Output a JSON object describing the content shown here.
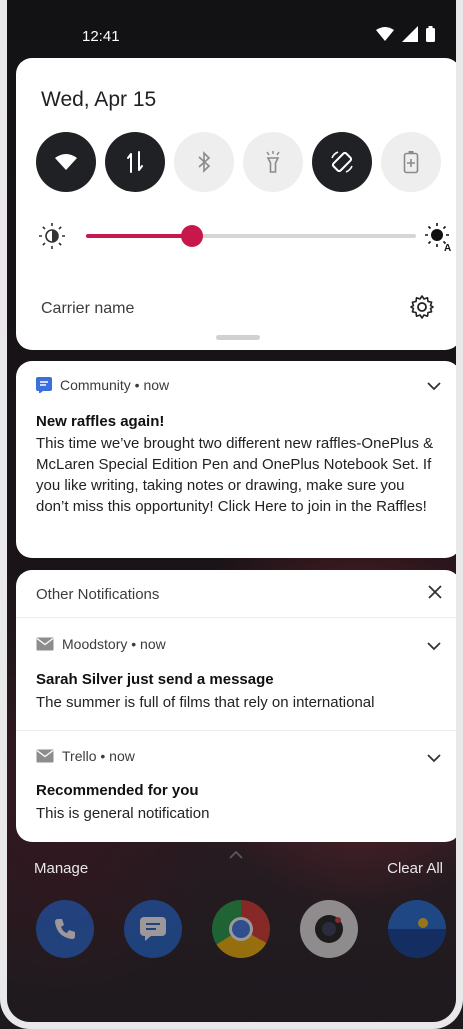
{
  "status_bar": {
    "time": "12:41"
  },
  "quick_settings": {
    "date": "Wed, Apr 15",
    "tiles": [
      {
        "name": "wifi",
        "active": true
      },
      {
        "name": "mobile-data",
        "active": true
      },
      {
        "name": "bluetooth",
        "active": false
      },
      {
        "name": "flashlight",
        "active": false
      },
      {
        "name": "auto-rotate",
        "active": true
      },
      {
        "name": "battery-saver",
        "active": false
      }
    ],
    "brightness_level": 0.32,
    "carrier": "Carrier name"
  },
  "community_notification": {
    "app": "Community • now",
    "title": "New raffles again!",
    "body": "This time we’ve brought two different new raffles-OnePlus & McLaren Special Edition Pen and OnePlus Notebook Set. If you like writing, taking notes or drawing, make sure you don’t miss this opportunity! Click Here to join in the Raffles!"
  },
  "other_notifications": {
    "header": "Other Notifications",
    "items": [
      {
        "app": "Moodstory • now",
        "title": "Sarah Silver just send a message",
        "body": "The summer is full of films that rely on international"
      },
      {
        "app": "Trello • now",
        "title": "Recommended for you",
        "body": "This is general notification"
      }
    ]
  },
  "footer": {
    "manage": "Manage",
    "clear_all": "Clear All"
  },
  "colors": {
    "accent": "#c8174c",
    "tile_on": "#202124",
    "tile_off": "#eeeeee",
    "card": "#ffffff"
  }
}
